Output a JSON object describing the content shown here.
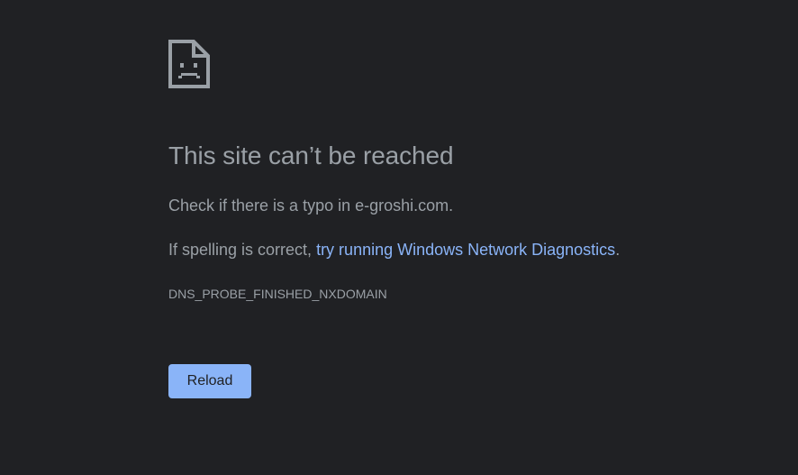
{
  "error": {
    "icon": "sad-page-icon",
    "title": "This site can’t be reached",
    "typo_text": "Check if there is a typo in e-groshi.com.",
    "spelling_prefix": "If spelling is correct, ",
    "diagnostics_link": "try running Windows Network Diagnostics",
    "spelling_suffix": ".",
    "code": "DNS_PROBE_FINISHED_NXDOMAIN",
    "reload_label": "Reload"
  },
  "colors": {
    "background": "#202124",
    "text": "#9aa0a6",
    "link": "#8ab4f8",
    "button": "#8ab4f8",
    "button_text": "#202124"
  }
}
